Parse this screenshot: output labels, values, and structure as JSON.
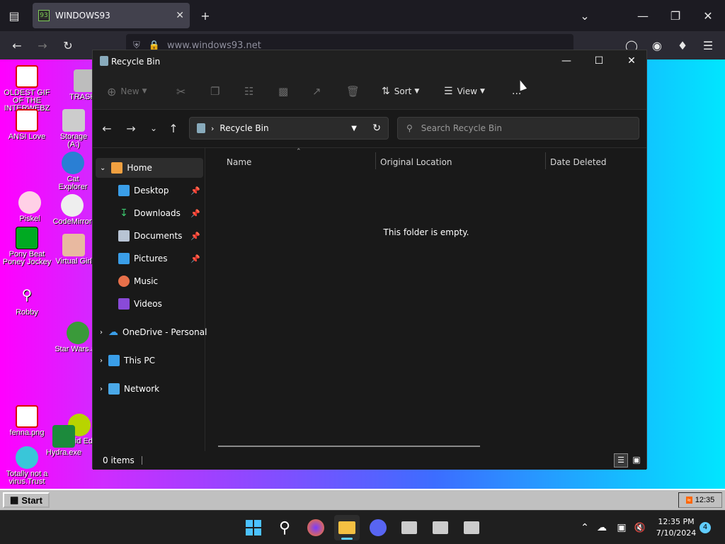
{
  "browser": {
    "tab_title": "WINDOWS93",
    "url": "www.windows93.net"
  },
  "desktop_icons": [
    {
      "label": "OLDEST GIF OF THE INTERWEBZ"
    },
    {
      "label": "TRASH"
    },
    {
      "label": "ANSI Love"
    },
    {
      "label": "Storage (A:)"
    },
    {
      "label": "Cat Explorer"
    },
    {
      "label": "Piskel"
    },
    {
      "label": "CodeMirror"
    },
    {
      "label": "Pony Beat Poney Jockey"
    },
    {
      "label": "Virtual Girl"
    },
    {
      "label": "Robby"
    },
    {
      "label": "Star Wars.avi"
    },
    {
      "label": "fenna.png"
    },
    {
      "label": "Acid Ed"
    },
    {
      "label": "Hydra.exe"
    },
    {
      "label": "Totally not a virus.Trust"
    }
  ],
  "w93_taskbar": {
    "start_label": "Start",
    "clock": "12:35"
  },
  "explorer": {
    "title": "Recycle Bin",
    "commands": {
      "new": "New",
      "sort": "Sort",
      "view": "View",
      "more": "..."
    },
    "address": {
      "location": "Recycle Bin"
    },
    "search": {
      "placeholder": "Search Recycle Bin"
    },
    "nav": {
      "home": "Home",
      "desktop": "Desktop",
      "downloads": "Downloads",
      "documents": "Documents",
      "pictures": "Pictures",
      "music": "Music",
      "videos": "Videos",
      "onedrive": "OneDrive - Personal",
      "thispc": "This PC",
      "network": "Network"
    },
    "columns": {
      "name": "Name",
      "original_location": "Original Location",
      "date_deleted": "Date Deleted"
    },
    "empty_message": "This folder is empty.",
    "status": "0 items"
  },
  "win_taskbar": {
    "time": "12:35 PM",
    "date": "7/10/2024",
    "notification_count": "4"
  },
  "colors": {
    "accent": "#60cdff",
    "desktop_gradient": [
      "#ff00ff",
      "#00e6ff"
    ]
  }
}
